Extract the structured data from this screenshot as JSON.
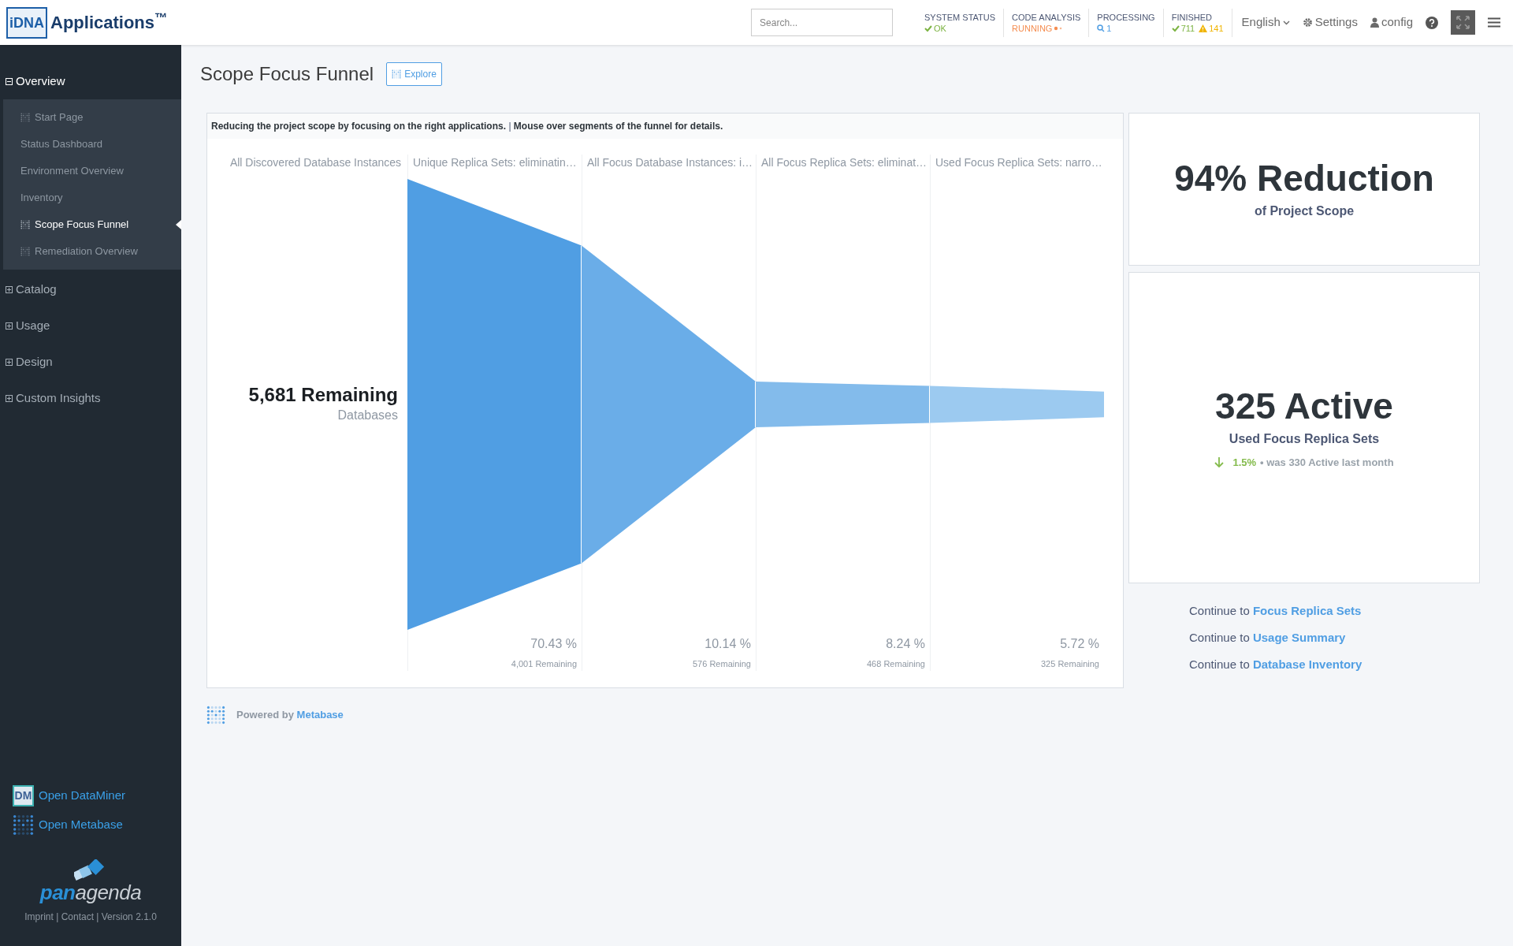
{
  "header": {
    "logo_mark": "iDNA",
    "app_name": "Applications$^{™}$",
    "search": {
      "placeholder": "Search..."
    },
    "status": [
      {
        "label": "SYSTEM STATUS",
        "values": [
          {
            "kind": "ok",
            "text": "OK"
          }
        ]
      },
      {
        "label": "CODE ANALYSIS",
        "values": [
          {
            "kind": "running",
            "text": "RUNNING"
          }
        ]
      },
      {
        "label": "PROCESSING",
        "values": [
          {
            "kind": "search",
            "text": "1"
          }
        ]
      },
      {
        "label": "FINISHED",
        "values": [
          {
            "kind": "ok",
            "text": "711"
          },
          {
            "kind": "warning",
            "text": "141"
          }
        ]
      }
    ],
    "language": "English",
    "settings": "Settings",
    "user": "config"
  },
  "sidebar": {
    "sections": [
      {
        "label": "Overview",
        "expanded": true,
        "children": [
          {
            "label": "Start Page",
            "kind": "metabase",
            "selected": false
          },
          {
            "label": "Status Dashboard",
            "kind": "plain",
            "selected": false
          },
          {
            "label": "Environment Overview",
            "kind": "plain",
            "selected": false
          },
          {
            "label": "Inventory",
            "kind": "plain",
            "selected": false
          },
          {
            "label": "Scope Focus Funnel",
            "kind": "metabase",
            "selected": true
          },
          {
            "label": "Remediation Overview",
            "kind": "metabase",
            "selected": false
          }
        ]
      },
      {
        "label": "Catalog",
        "expanded": false
      },
      {
        "label": "Usage",
        "expanded": false
      },
      {
        "label": "Design",
        "expanded": false
      },
      {
        "label": "Custom Insights",
        "expanded": false
      }
    ],
    "links": [
      {
        "kind": "dataminer",
        "badge": "DM",
        "label": "Open DataMiner"
      },
      {
        "kind": "metabase",
        "label": "Open Metabase"
      }
    ],
    "brand": {
      "parts": [
        "pan",
        "agenda"
      ]
    },
    "footer": "Imprint | Contact | Version 2.1.0"
  },
  "page": {
    "title": "Scope Focus Funnel",
    "explore": "Explore",
    "funnel": {
      "description": "**Reducing the project scope by focusing on the right applications.** | **Mouse over segments of the funnel for details.**",
      "first_label": "All Discovered Database Instances",
      "start_value": "5,681 Remaining",
      "start_unit": "Databases",
      "stages": [
        {
          "label": "Unique Replica Sets: eliminatin…",
          "percent": "70.43 %",
          "remaining": "4,001 Remaining"
        },
        {
          "label": "All Focus Database Instances: i…",
          "percent": "10.14 %",
          "remaining": "576 Remaining"
        },
        {
          "label": "All Focus Replica Sets: eliminat…",
          "percent": "8.24 %",
          "remaining": "468 Remaining"
        },
        {
          "label": "Used Focus Replica Sets: narro…",
          "percent": "5.72 %",
          "remaining": "325 Remaining"
        }
      ]
    },
    "stats": [
      {
        "value": "94% Reduction",
        "caption": "of Project Scope"
      },
      {
        "value": "325 Active",
        "caption": "Used Focus Replica Sets",
        "trend": {
          "kind": "down",
          "change": "1.5%",
          "note": "• was 330 Active last month"
        }
      }
    ],
    "continue_links": [
      {
        "prefix": "Continue to",
        "link": "Focus Replica Sets"
      },
      {
        "prefix": "Continue to",
        "link": "Usage Summary"
      },
      {
        "prefix": "Continue to",
        "link": "Database Inventory"
      }
    ],
    "powered": {
      "prefix": "Powered by",
      "link": "Metabase"
    }
  }
}
